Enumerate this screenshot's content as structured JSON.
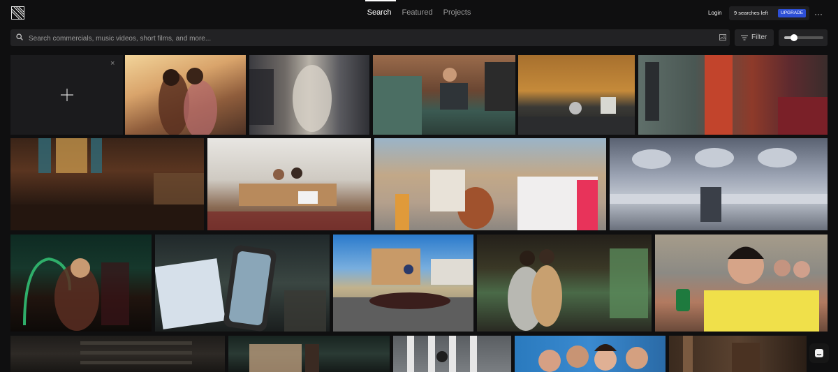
{
  "nav": {
    "tabs": [
      {
        "label": "Search",
        "active": true
      },
      {
        "label": "Featured",
        "active": false
      },
      {
        "label": "Projects",
        "active": false
      }
    ]
  },
  "header": {
    "login_label": "Login",
    "searches_left_label": "9 searches left",
    "upgrade_label": "UPGRADE",
    "more_label": "···"
  },
  "search": {
    "placeholder": "Search commercials, music videos, short films, and more...",
    "value": ""
  },
  "toolbar": {
    "filter_label": "Filter",
    "grid_size_level": 0.25
  },
  "add_tile": {
    "plus_icon": "plus-icon",
    "close_label": "×"
  },
  "colors": {
    "background": "#0f0f10",
    "accent": "#2d4fd6",
    "panel": "#222224"
  }
}
